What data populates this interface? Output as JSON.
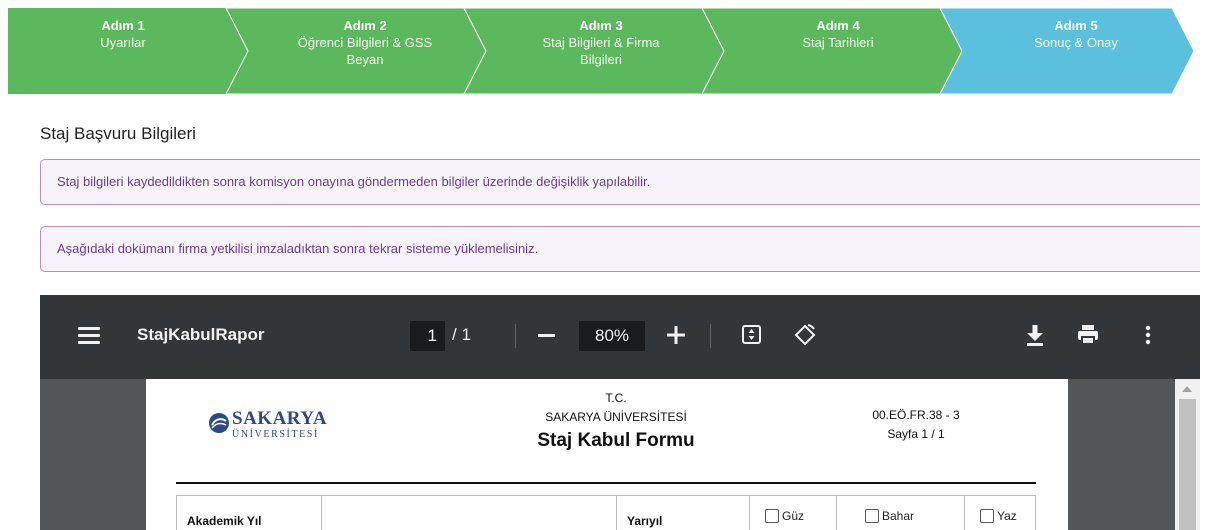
{
  "stepper": {
    "steps": [
      {
        "num": "Adım 1",
        "label": "Uyarılar",
        "state": "complete",
        "color": "#5cb85c"
      },
      {
        "num": "Adım 2",
        "label": "Öğrenci Bilgileri & GSS Beyan",
        "state": "complete",
        "color": "#5cb85c"
      },
      {
        "num": "Adım 3",
        "label": "Staj Bilgileri & Firma Bilgileri",
        "state": "complete",
        "color": "#5cb85c"
      },
      {
        "num": "Adım 4",
        "label": "Staj Tarihleri",
        "state": "complete",
        "color": "#5cb85c"
      },
      {
        "num": "Adım 5",
        "label": "Sonuç & Onay",
        "state": "active",
        "color": "#5bc0de"
      }
    ]
  },
  "page_title": "Staj Başvuru Bilgileri",
  "alerts": [
    "Staj bilgileri kaydedildikten sonra komisyon onayına göndermeden bilgiler üzerinde değişiklik yapılabilir.",
    "Aşağıdaki dokümanı firma yetkilisi imzaladıktan sonra tekrar sisteme yüklemelisiniz."
  ],
  "pdf_viewer": {
    "file_name": "StajKabulRapor",
    "current_page": "1",
    "page_separator": "/ 1",
    "zoom": "80%",
    "icons": [
      "menu-icon",
      "zoom-out-icon",
      "zoom-in-icon",
      "fit-page-icon",
      "rotate-icon",
      "download-icon",
      "print-icon",
      "more-options-icon"
    ]
  },
  "document": {
    "logo_name": "SAKARYA",
    "logo_sub": "ÜNİVERSİTESİ",
    "header_tc": "T.C.",
    "header_university": "SAKARYA ÜNİVERSİTESİ",
    "form_title": "Staj Kabul Formu",
    "form_code": "00.EÖ.FR.38 - 3",
    "page_info": "Sayfa 1 / 1",
    "table": {
      "academic_year_label": "Akademik Yıl",
      "semester_label": "Yarıyıl",
      "options": [
        "Güz",
        "Bahar",
        "Yaz"
      ]
    }
  }
}
